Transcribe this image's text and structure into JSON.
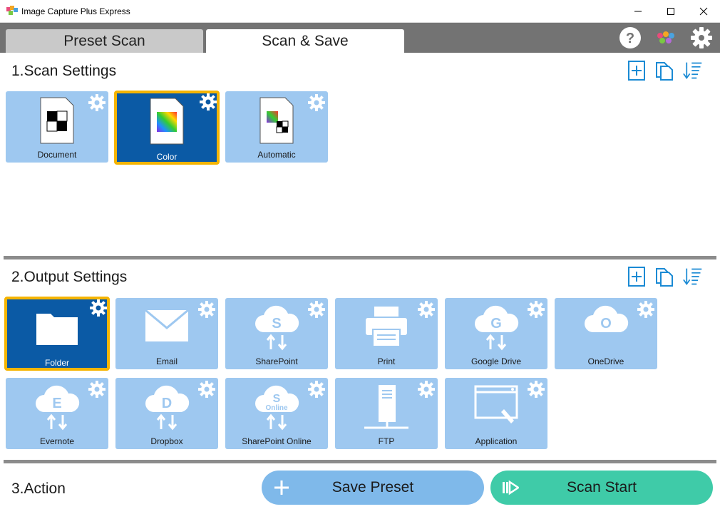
{
  "window": {
    "title": "Image Capture Plus Express"
  },
  "tabs": [
    {
      "label": "Preset Scan"
    },
    {
      "label": "Scan & Save"
    }
  ],
  "scan_settings": {
    "title": "1.Scan Settings",
    "tiles": [
      {
        "label": "Document"
      },
      {
        "label": "Color"
      },
      {
        "label": "Automatic"
      }
    ]
  },
  "output_settings": {
    "title": "2.Output Settings",
    "tiles": [
      {
        "label": "Folder"
      },
      {
        "label": "Email"
      },
      {
        "label": "SharePoint"
      },
      {
        "label": "Print"
      },
      {
        "label": "Google Drive"
      },
      {
        "label": "OneDrive"
      },
      {
        "label": "Evernote"
      },
      {
        "label": "Dropbox"
      },
      {
        "label": "SharePoint Online"
      },
      {
        "label": "FTP"
      },
      {
        "label": "Application"
      }
    ]
  },
  "action": {
    "title": "3.Action",
    "save_label": "Save Preset",
    "start_label": "Scan Start"
  },
  "colors": {
    "tile": "#9ec8f0",
    "tile_selected": "#0b5aa5",
    "highlight": "#f5b400",
    "accent": "#1a8ad4",
    "save": "#7fb9ea",
    "start": "#3fcba8"
  }
}
